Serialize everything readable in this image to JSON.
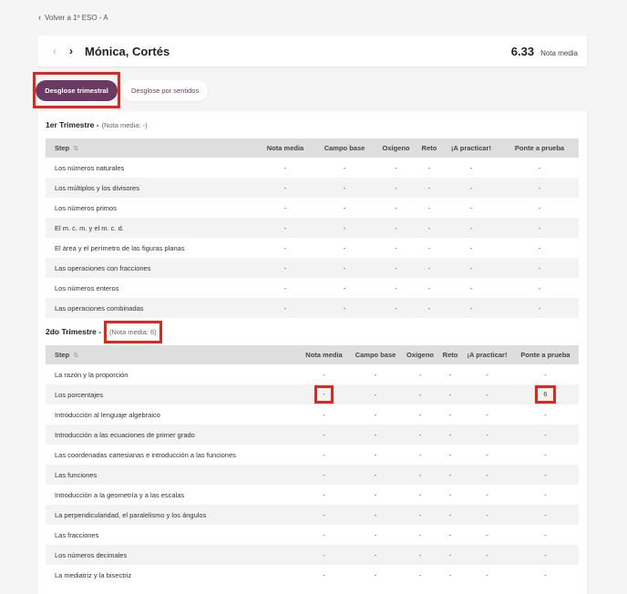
{
  "back": {
    "label": "Volver a 1º ESO - A"
  },
  "student": {
    "name": "Mónica, Cortés",
    "average": "6.33",
    "average_label": "Nota media"
  },
  "tabs": [
    {
      "label": "Desglose trimestral"
    },
    {
      "label": "Desglose por sentidos"
    }
  ],
  "columns": [
    "Step",
    "Nota media",
    "Campo base",
    "Oxígeno",
    "Reto",
    "¡A practicar!",
    "Ponte a prueba"
  ],
  "trimesters": [
    {
      "title": "1er Trimestre -",
      "subtitle": "(Nota media: -)",
      "rows": [
        [
          "Los números naturales",
          "-",
          "-",
          "-",
          "-",
          "-",
          "-"
        ],
        [
          "Los múltiplos y los divisores",
          "-",
          "-",
          "-",
          "-",
          "-",
          "-"
        ],
        [
          "Los números primos",
          "-",
          "-",
          "-",
          "-",
          "-",
          "-"
        ],
        [
          "El m. c. m. y el m. c. d.",
          "-",
          "-",
          "-",
          "-",
          "-",
          "-"
        ],
        [
          "El área y el perímetro de las figuras planas",
          "-",
          "-",
          "-",
          "-",
          "-",
          "-"
        ],
        [
          "Las operaciones con fracciones",
          "-",
          "-",
          "-",
          "-",
          "-",
          "-"
        ],
        [
          "Los números enteros",
          "-",
          "-",
          "-",
          "-",
          "-",
          "-"
        ],
        [
          "Las operaciones combinadas",
          "-",
          "-",
          "-",
          "-",
          "-",
          "-"
        ]
      ]
    },
    {
      "title": "2do Trimestre -",
      "subtitle": "(Nota media: 6)",
      "rows": [
        [
          "La razón y la proporción",
          "-",
          "-",
          "-",
          "-",
          "-",
          "-"
        ],
        [
          "Los porcentajes",
          "-",
          "-",
          "-",
          "-",
          "-",
          "6"
        ],
        [
          "Introducción al lenguaje algebraico",
          "-",
          "-",
          "-",
          "-",
          "-",
          "-"
        ],
        [
          "Introducción a las ecuaciones de primer grado",
          "-",
          "-",
          "-",
          "-",
          "-",
          "-"
        ],
        [
          "Las coordenadas cartesianas e introducción a las funciones",
          "-",
          "-",
          "-",
          "-",
          "-",
          "-"
        ],
        [
          "Las funciones",
          "-",
          "-",
          "-",
          "-",
          "-",
          "-"
        ],
        [
          "Introducción a la geometría y a las escalas",
          "-",
          "-",
          "-",
          "-",
          "-",
          "-"
        ],
        [
          "La perpendicularidad, el paralelismo y los ángulos",
          "-",
          "-",
          "-",
          "-",
          "-",
          "-"
        ],
        [
          "Las fracciones",
          "-",
          "-",
          "-",
          "-",
          "-",
          "-"
        ],
        [
          "Los números decimales",
          "-",
          "-",
          "-",
          "-",
          "-",
          "-"
        ],
        [
          "La mediatriz y la bisectriz",
          "-",
          "-",
          "-",
          "-",
          "-",
          "-"
        ]
      ]
    }
  ]
}
